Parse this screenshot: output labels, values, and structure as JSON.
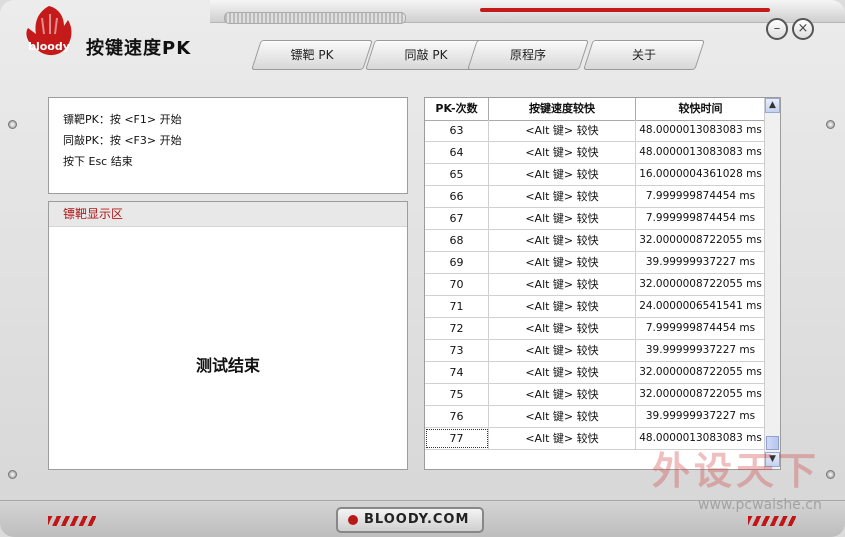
{
  "app": {
    "logo_text": "bloody",
    "title": "按键速度PK"
  },
  "window_controls": {
    "minimize": "–",
    "close": "×"
  },
  "tabs": [
    {
      "label": "镖靶 PK"
    },
    {
      "label": "同敲 PK"
    },
    {
      "label": "原程序"
    },
    {
      "label": "关于"
    }
  ],
  "info": {
    "line1": "镖靶PK：按 <F1> 开始",
    "line2": "同敲PK：按 <F3> 开始",
    "line3": "按下 Esc 结束"
  },
  "display": {
    "header": "镖靶显示区",
    "message": "测试结束"
  },
  "table": {
    "headers": [
      "PK-次数",
      "按键速度较快",
      "较快时间"
    ],
    "rows": [
      [
        "63",
        "<Alt 键> 较快",
        "48.0000013083083 ms"
      ],
      [
        "64",
        "<Alt 键> 较快",
        "48.0000013083083 ms"
      ],
      [
        "65",
        "<Alt 键> 较快",
        "16.0000004361028 ms"
      ],
      [
        "66",
        "<Alt 键> 较快",
        "7.999999874454 ms"
      ],
      [
        "67",
        "<Alt 键> 较快",
        "7.999999874454 ms"
      ],
      [
        "68",
        "<Alt 键> 较快",
        "32.0000008722055 ms"
      ],
      [
        "69",
        "<Alt 键> 较快",
        "39.99999937227 ms"
      ],
      [
        "70",
        "<Alt 键> 较快",
        "32.0000008722055 ms"
      ],
      [
        "71",
        "<Alt 键> 较快",
        "24.0000006541541 ms"
      ],
      [
        "72",
        "<Alt 键> 较快",
        "7.999999874454 ms"
      ],
      [
        "73",
        "<Alt 键> 较快",
        "39.99999937227 ms"
      ],
      [
        "74",
        "<Alt 键> 较快",
        "32.0000008722055 ms"
      ],
      [
        "75",
        "<Alt 键> 较快",
        "32.0000008722055 ms"
      ],
      [
        "76",
        "<Alt 键> 较快",
        "39.99999937227 ms"
      ],
      [
        "77",
        "<Alt 键> 较快",
        "48.0000013083083 ms"
      ]
    ],
    "selected_index": 14
  },
  "footer": {
    "brand": "BLOODY.COM"
  },
  "watermark": {
    "text": "外设天下",
    "url": "www.pcwaishe.cn"
  },
  "colors": {
    "accent": "#c51a1a",
    "panel_header_text": "#b01818"
  },
  "icons": {
    "logo": "bloody-hand-logo-icon",
    "scroll_up": "chevron-up-icon",
    "scroll_down": "chevron-down-icon"
  }
}
